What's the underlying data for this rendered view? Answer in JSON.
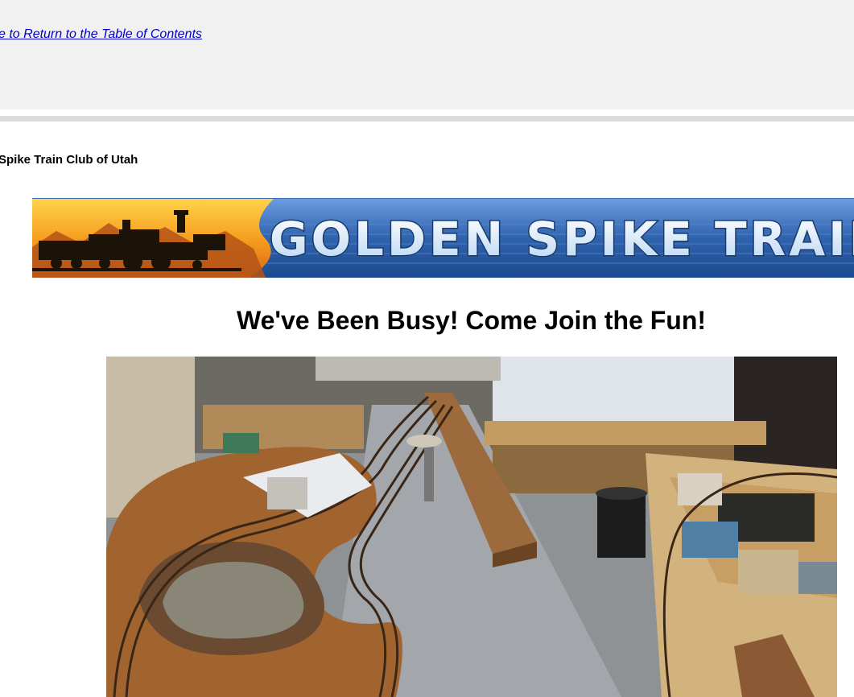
{
  "nav": {
    "toc_link": "e to Return to the Table of Contents"
  },
  "club": {
    "name": "Spike Train Club of Utah"
  },
  "banner": {
    "text": "GOLDEN SPIKE TRAIN CLU"
  },
  "main": {
    "headline": "We've Been Busy! Come Join the Fun!"
  },
  "colors": {
    "top_bar_bg": "#f1f1f1",
    "link": "#0000cc",
    "banner_blue": "#2f63ad",
    "banner_orange": "#f0a020"
  }
}
